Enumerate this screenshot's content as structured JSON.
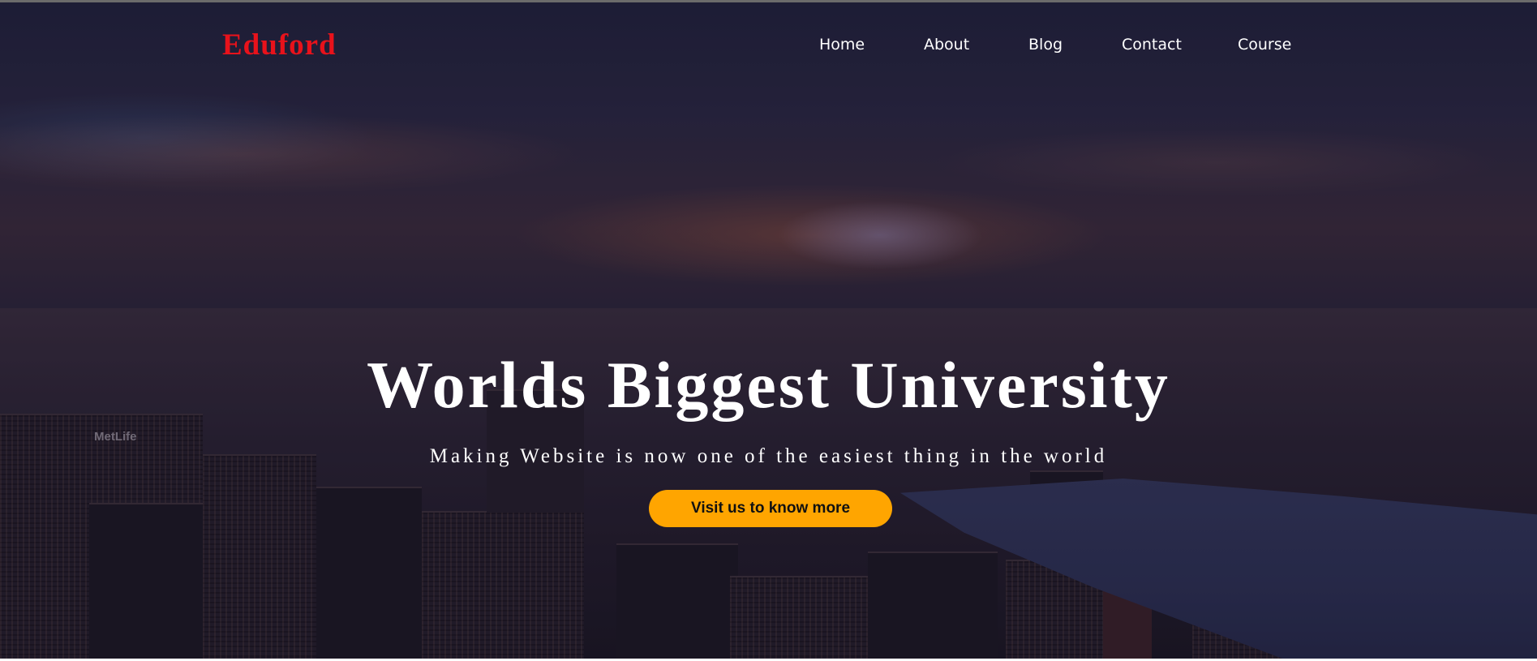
{
  "brand": {
    "name": "Eduford",
    "color": "#e8121b"
  },
  "nav": {
    "items": [
      {
        "label": "Home"
      },
      {
        "label": "About"
      },
      {
        "label": "Blog"
      },
      {
        "label": "Contact"
      },
      {
        "label": "Course"
      }
    ]
  },
  "hero": {
    "title": "Worlds Biggest University",
    "subtitle": "Making Website is now one of the easiest thing in the world",
    "cta_label": "Visit us to know more",
    "cta_color": "#ffa500",
    "background_image": "city-skyline-at-dusk",
    "building_sign": "MetLife"
  }
}
